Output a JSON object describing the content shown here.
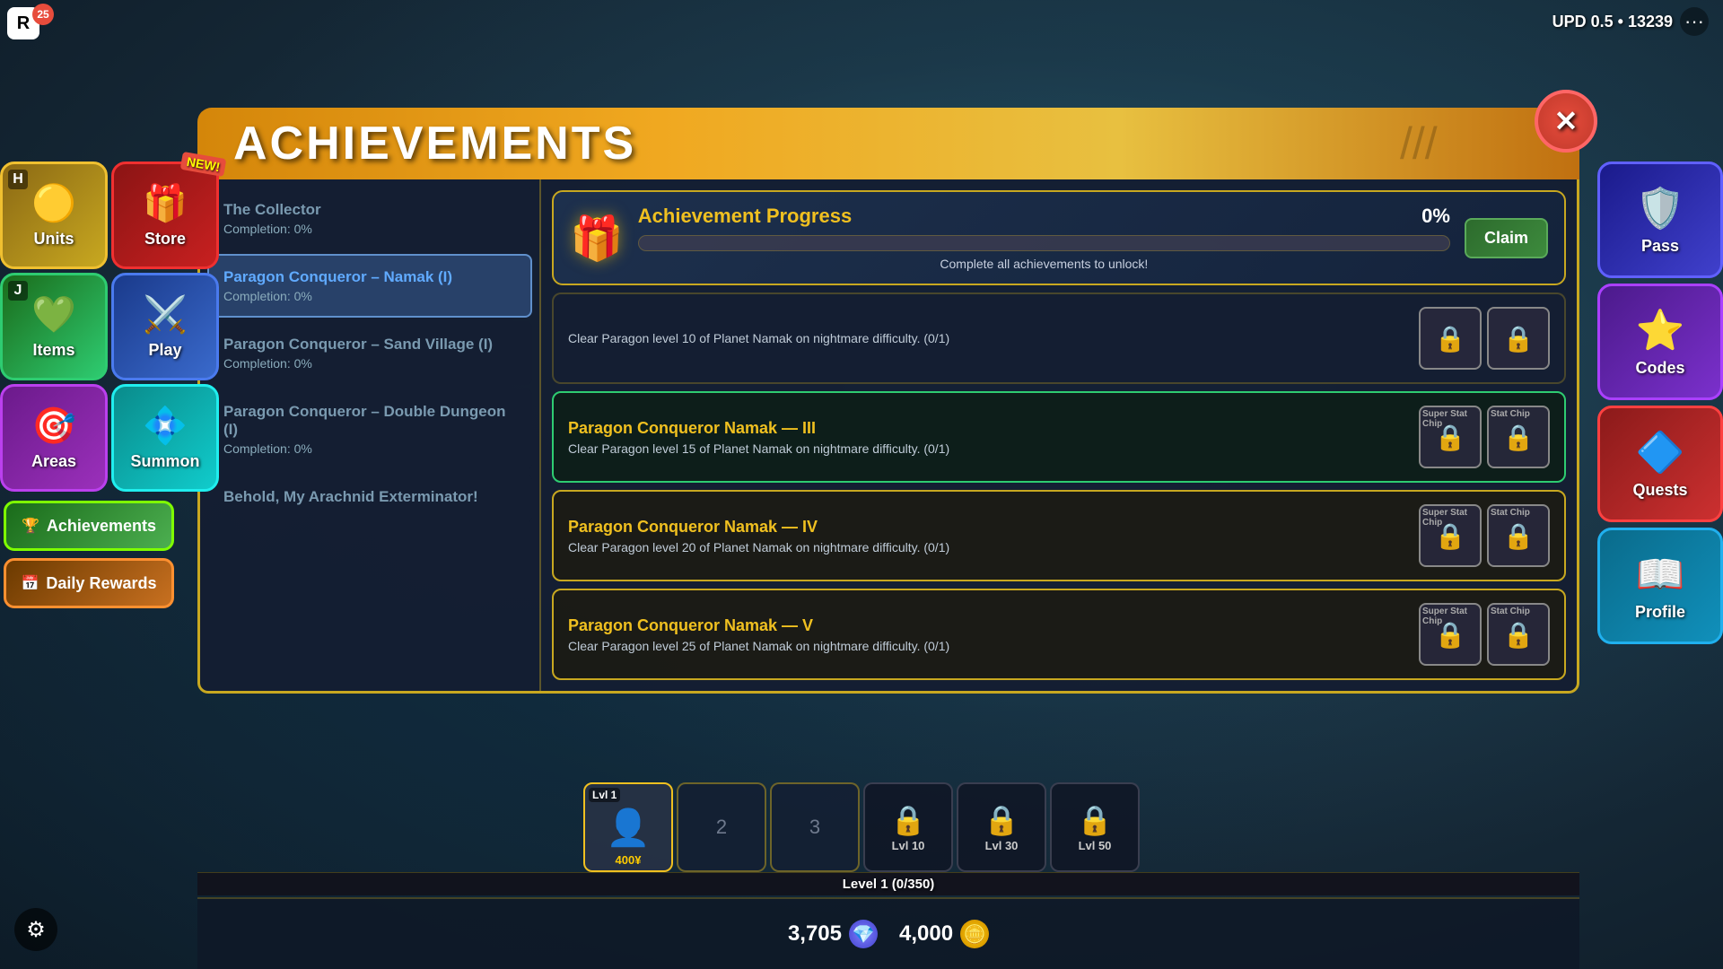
{
  "topbar": {
    "version": "UPD 0.5 • 13239",
    "dots_label": "···",
    "roblox_label": "R",
    "notif_count": "25"
  },
  "left_nav": {
    "row1": [
      {
        "id": "units",
        "label": "Units",
        "icon": "🟡",
        "badge": "H",
        "class": "btn-units"
      },
      {
        "id": "store",
        "label": "Store",
        "icon": "🎁",
        "badge": null,
        "new": true,
        "class": "btn-store"
      }
    ],
    "row2": [
      {
        "id": "items",
        "label": "Items",
        "icon": "💚",
        "badge": "J",
        "class": "btn-items"
      },
      {
        "id": "play",
        "label": "Play",
        "icon": "⚔️",
        "badge": null,
        "class": "btn-play"
      }
    ],
    "row3": [
      {
        "id": "areas",
        "label": "Areas",
        "icon": "🔵",
        "badge": null,
        "class": "btn-areas"
      },
      {
        "id": "summon",
        "label": "Summon",
        "icon": "💠",
        "badge": null,
        "class": "btn-summon"
      }
    ],
    "achievements_label": "Achievements",
    "daily_rewards_label": "Daily Rewards"
  },
  "right_nav": [
    {
      "id": "pass",
      "label": "Pass",
      "icon": "🛡️",
      "class": "btn-pass"
    },
    {
      "id": "codes",
      "label": "Codes",
      "icon": "⭐",
      "class": "btn-codes"
    },
    {
      "id": "quests",
      "label": "Quests",
      "icon": "🔷",
      "class": "btn-quests"
    },
    {
      "id": "profile",
      "label": "Profile",
      "icon": "📖",
      "class": "btn-profile"
    }
  ],
  "panel": {
    "title": "ACHIEVEMENTS",
    "close_label": "✕",
    "progress": {
      "icon": "🎁",
      "title": "Achievement Progress",
      "pct": "0%",
      "bar_width": "0",
      "subtitle": "Complete all achievements to unlock!",
      "claim_label": "Claim"
    },
    "list": [
      {
        "title": "The Collector",
        "completion": "Completion: 0%",
        "active": false
      },
      {
        "title": "Paragon Conqueror – Namak (I)",
        "completion": "Completion: 0%",
        "active": true
      },
      {
        "title": "Paragon Conqueror – Sand Village (I)",
        "completion": "Completion: 0%",
        "active": false
      },
      {
        "title": "Paragon Conqueror – Double Dungeon (I)",
        "completion": "Completion: 0%",
        "active": false
      },
      {
        "title": "Behold, My Arachnid Exterminator!",
        "completion": "",
        "active": false
      }
    ],
    "achievements": [
      {
        "title": "Paragon Conqueror Namak — III",
        "title_color": "gold",
        "desc": "Clear Paragon level 15 of Planet Namak on nightmare difficulty. (0/1)",
        "rewards": [
          "Super Stat Chip",
          "Stat Chip"
        ],
        "border": "green-border"
      },
      {
        "title": "Paragon Conqueror Namak — IV",
        "title_color": "gold",
        "desc": "Clear Paragon level 20 of Planet Namak on nightmare difficulty. (0/1)",
        "rewards": [
          "Super Stat Chip",
          "Stat Chip"
        ],
        "border": "gold-border"
      },
      {
        "title": "Paragon Conqueror Namak — V",
        "title_color": "gold",
        "desc": "Clear Paragon level 25 of Planet Namak on nightmare difficulty. (0/1)",
        "rewards": [
          "Super Stat Chip",
          "Stat Chip"
        ],
        "border": "gold-border"
      }
    ],
    "first_ach": {
      "desc": "Clear Paragon level 10 of Planet Namak on nightmare difficulty. (0/1)",
      "rewards": [
        "",
        ""
      ]
    }
  },
  "currency": {
    "gems": "3,705",
    "coins": "4,000"
  },
  "xp_bar": {
    "label": "Level 1 (0/350)",
    "fill_pct": 0
  },
  "char_slots": [
    {
      "type": "active",
      "level": "Lvl 1",
      "cost": "400¥"
    },
    {
      "type": "empty",
      "num": "2",
      "cost": ""
    },
    {
      "type": "empty",
      "num": "3",
      "cost": ""
    },
    {
      "type": "locked",
      "lock_level": "Lvl 10"
    },
    {
      "type": "locked",
      "lock_level": "Lvl 30"
    },
    {
      "type": "locked",
      "lock_level": "Lvl 50"
    }
  ],
  "settings_icon": "⚙"
}
